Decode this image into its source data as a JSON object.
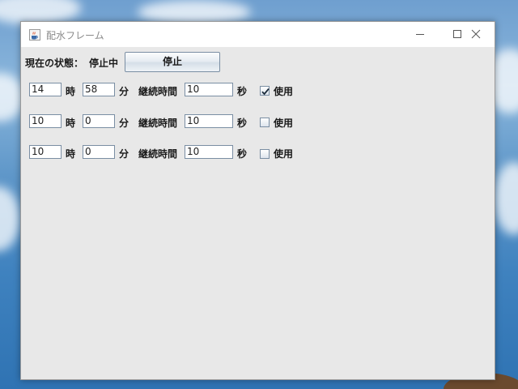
{
  "window": {
    "title": "配水フレーム",
    "app_icon": "java-cup-icon",
    "controls": [
      "minimize-icon",
      "maximize-icon",
      "close-icon"
    ]
  },
  "status": {
    "label": "現在の状態：",
    "value": "停止中",
    "button_label": "停止"
  },
  "schedule": {
    "hour_unit": "時",
    "minute_unit": "分",
    "duration_label": "継続時間",
    "second_unit": "秒",
    "use_label": "使用",
    "rows": [
      {
        "hour": "14",
        "minute": "58",
        "duration": "10",
        "use": true
      },
      {
        "hour": "10",
        "minute": "0",
        "duration": "10",
        "use": false
      },
      {
        "hour": "10",
        "minute": "0",
        "duration": "10",
        "use": false
      }
    ]
  }
}
